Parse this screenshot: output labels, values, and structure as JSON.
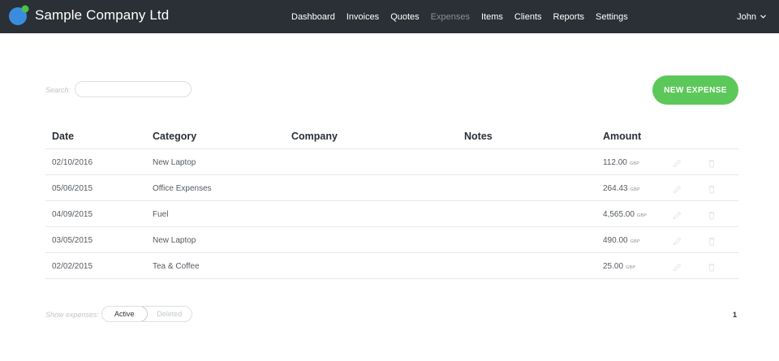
{
  "app": {
    "company_name": "Sample Company Ltd",
    "logo_icon": "logo-icon",
    "brand_colors": {
      "topbar": "#2b3036",
      "accent": "#5cc85a",
      "logo_blue": "#3a8dde",
      "logo_green": "#4cc04a"
    }
  },
  "nav": {
    "items": [
      {
        "label": "Dashboard",
        "active": false
      },
      {
        "label": "Invoices",
        "active": false
      },
      {
        "label": "Quotes",
        "active": false
      },
      {
        "label": "Expenses",
        "active": true
      },
      {
        "label": "Items",
        "active": false
      },
      {
        "label": "Clients",
        "active": false
      },
      {
        "label": "Reports",
        "active": false
      },
      {
        "label": "Settings",
        "active": false
      }
    ],
    "user": {
      "name": "John",
      "icon": "chevron-down-icon"
    }
  },
  "search": {
    "label": "Search:",
    "value": "",
    "placeholder": ""
  },
  "actions": {
    "new_expense_label": "NEW EXPENSE"
  },
  "table": {
    "headers": {
      "date": "Date",
      "category": "Category",
      "company": "Company",
      "notes": "Notes",
      "amount": "Amount"
    },
    "rows": [
      {
        "date": "02/10/2016",
        "category": "New Laptop",
        "company": "",
        "notes": "",
        "amount": "112.00",
        "currency": "GBP"
      },
      {
        "date": "05/06/2015",
        "category": "Office Expenses",
        "company": "",
        "notes": "",
        "amount": "264.43",
        "currency": "GBP"
      },
      {
        "date": "04/09/2015",
        "category": "Fuel",
        "company": "",
        "notes": "",
        "amount": "4,565.00",
        "currency": "GBP"
      },
      {
        "date": "03/05/2015",
        "category": "New Laptop",
        "company": "",
        "notes": "",
        "amount": "490.00",
        "currency": "GBP"
      },
      {
        "date": "02/02/2015",
        "category": "Tea & Coffee",
        "company": "",
        "notes": "",
        "amount": "25.00",
        "currency": "GBP"
      }
    ],
    "row_action_icons": [
      "pencil-icon",
      "trash-icon"
    ]
  },
  "footer": {
    "show_label": "Show expenses:",
    "toggle": {
      "active_label": "Active",
      "deleted_label": "Deleted",
      "selected": "Active"
    },
    "pagination": {
      "current_page": "1"
    }
  }
}
